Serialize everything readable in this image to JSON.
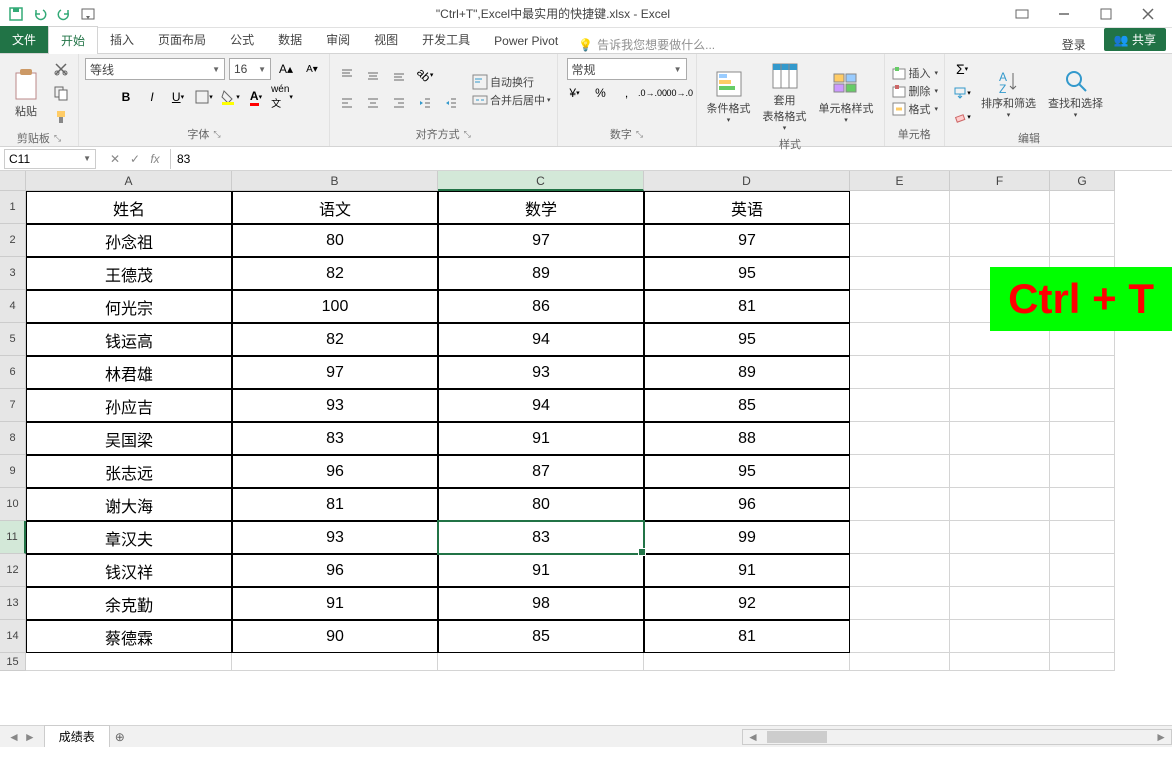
{
  "titlebar": {
    "title": "\"Ctrl+T\",Excel中最实用的快捷键.xlsx - Excel"
  },
  "tabs": {
    "file": "文件",
    "items": [
      "开始",
      "插入",
      "页面布局",
      "公式",
      "数据",
      "审阅",
      "视图",
      "开发工具",
      "Power Pivot"
    ],
    "active_index": 0,
    "tellme": "告诉我您想要做什么...",
    "login": "登录",
    "share": "共享"
  },
  "ribbon": {
    "clipboard": {
      "paste": "粘贴",
      "label": "剪贴板"
    },
    "font": {
      "name": "等线",
      "size": "16",
      "label": "字体"
    },
    "alignment": {
      "wrap": "自动换行",
      "merge": "合并后居中",
      "label": "对齐方式"
    },
    "number": {
      "format": "常规",
      "label": "数字"
    },
    "styles": {
      "cond": "条件格式",
      "table": "套用\n表格格式",
      "cell": "单元格样式",
      "label": "样式"
    },
    "cells": {
      "insert": "插入",
      "delete": "删除",
      "format": "格式",
      "label": "单元格"
    },
    "editing": {
      "sort": "排序和筛选",
      "find": "查找和选择",
      "label": "编辑"
    }
  },
  "formula_bar": {
    "name_box": "C11",
    "fx_value": "83"
  },
  "columns": [
    "A",
    "B",
    "C",
    "D",
    "E",
    "F",
    "G"
  ],
  "selected_col_index": 2,
  "selected_row_index": 10,
  "rows": [
    {
      "n": "1",
      "a": "姓名",
      "b": "语文",
      "c": "数学",
      "d": "英语"
    },
    {
      "n": "2",
      "a": "孙念祖",
      "b": "80",
      "c": "97",
      "d": "97"
    },
    {
      "n": "3",
      "a": "王德茂",
      "b": "82",
      "c": "89",
      "d": "95"
    },
    {
      "n": "4",
      "a": "何光宗",
      "b": "100",
      "c": "86",
      "d": "81"
    },
    {
      "n": "5",
      "a": "钱运高",
      "b": "82",
      "c": "94",
      "d": "95"
    },
    {
      "n": "6",
      "a": "林君雄",
      "b": "97",
      "c": "93",
      "d": "89"
    },
    {
      "n": "7",
      "a": "孙应吉",
      "b": "93",
      "c": "94",
      "d": "85"
    },
    {
      "n": "8",
      "a": "吴国梁",
      "b": "83",
      "c": "91",
      "d": "88"
    },
    {
      "n": "9",
      "a": "张志远",
      "b": "96",
      "c": "87",
      "d": "95"
    },
    {
      "n": "10",
      "a": "谢大海",
      "b": "81",
      "c": "80",
      "d": "96"
    },
    {
      "n": "11",
      "a": "章汉夫",
      "b": "93",
      "c": "83",
      "d": "99"
    },
    {
      "n": "12",
      "a": "钱汉祥",
      "b": "96",
      "c": "91",
      "d": "91"
    },
    {
      "n": "13",
      "a": "余克勤",
      "b": "91",
      "c": "98",
      "d": "92"
    },
    {
      "n": "14",
      "a": "蔡德霖",
      "b": "90",
      "c": "85",
      "d": "81"
    },
    {
      "n": "15",
      "a": "",
      "b": "",
      "c": "",
      "d": ""
    }
  ],
  "sheets": {
    "name": "成绩表"
  },
  "annotation": "Ctrl + T"
}
